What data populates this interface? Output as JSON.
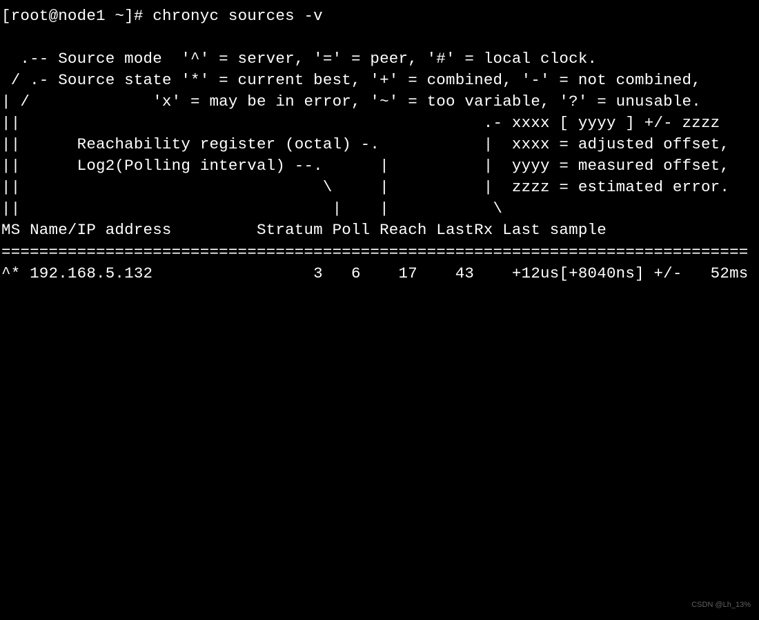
{
  "prompt": "[root@node1 ~]# ",
  "command": "chronyc sources -v",
  "legend": {
    "line1": "  .-- Source mode  '^' = server, '=' = peer, '#' = local clock.",
    "line2": " / .- Source state '*' = current best, '+' = combined, '-' = not combined,",
    "line3": "| /             'x' = may be in error, '~' = too variable, '?' = unusable.",
    "line4": "||                                                 .- xxxx [ yyyy ] +/- zzzz",
    "line5": "||      Reachability register (octal) -.           |  xxxx = adjusted offset,",
    "line6": "||      Log2(Polling interval) --.      |          |  yyyy = measured offset,",
    "line7": "||                                \\     |          |  zzzz = estimated error.",
    "line8": "||                                 |    |           \\"
  },
  "header": "MS Name/IP address         Stratum Poll Reach LastRx Last sample",
  "separator": "===============================================================================",
  "row": {
    "ms": "^*",
    "address": "192.168.5.132",
    "stratum": "3",
    "poll": "6",
    "reach": "17",
    "lastrx": "43",
    "last_sample": "+12us[+8040ns] +/-   52ms",
    "formatted": "^* 192.168.5.132                 3   6    17    43    +12us[+8040ns] +/-   52ms"
  },
  "watermark": "CSDN @Lh_13%"
}
